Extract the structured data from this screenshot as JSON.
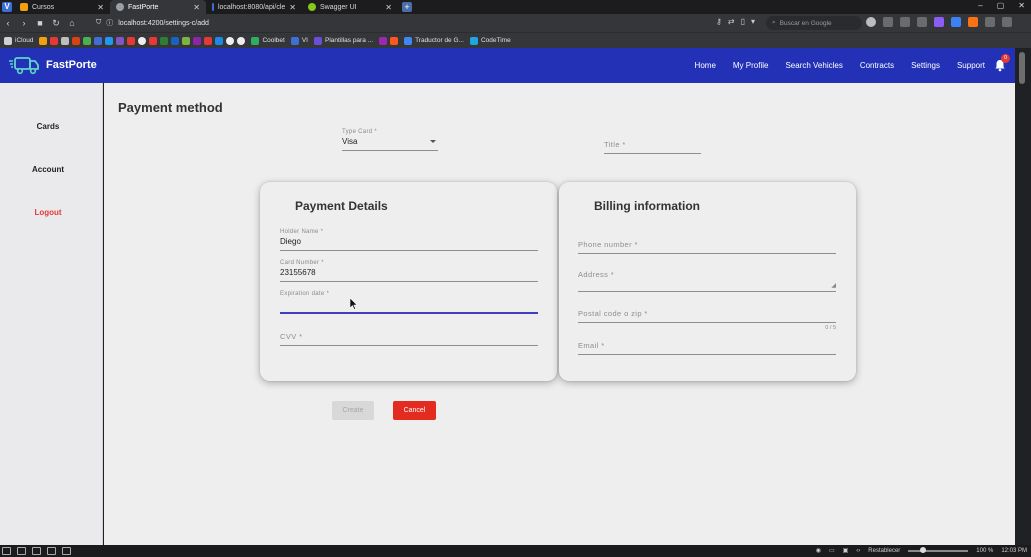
{
  "browser": {
    "tabs": [
      {
        "title": "Cursos",
        "favicon_color": "#f2a10c",
        "active": false
      },
      {
        "title": "FastPorte",
        "favicon_color": "#9aa0a6",
        "active": true
      },
      {
        "title": "localhost:8080/api/cle",
        "favicon_color": "#3a6fd8",
        "active": false
      },
      {
        "title": "Swagger UI",
        "favicon_color": "#85c81a",
        "active": false
      }
    ],
    "url": "localhost:4200/settings-c/add",
    "search_placeholder": "Buscar en Google",
    "bookmarks": [
      {
        "label": "iCloud",
        "color": "#cfcfcf"
      },
      {
        "label": "Coolbet",
        "color": "#2fae62"
      },
      {
        "label": "VI",
        "color": "#3f6fd6"
      },
      {
        "label": "Plantillas para ...",
        "color": "#6b4fd8"
      },
      {
        "label": "Traductor de G...",
        "color": "#4285f4"
      },
      {
        "label": "CodeTime",
        "color": "#1fa5e0"
      }
    ]
  },
  "app": {
    "name": "FastPorte",
    "nav": [
      "Home",
      "My Profile",
      "Search Vehicles",
      "Contracts",
      "Settings",
      "Support"
    ],
    "notification_count": "0",
    "colors": {
      "appbar": "#2331b6",
      "cancel": "#e32b1f",
      "logout": "#e53935",
      "focus_line": "#3f3fbf"
    }
  },
  "sidebar": {
    "items": [
      {
        "label": "Cards"
      },
      {
        "label": "Account"
      },
      {
        "label": "Logout"
      }
    ]
  },
  "page": {
    "title": "Payment method",
    "type_card": {
      "label": "Type Card *",
      "value": "Visa"
    },
    "title_field": {
      "placeholder": "Title *"
    }
  },
  "payment_details": {
    "heading": "Payment Details",
    "holder_name": {
      "label": "Holder Name *",
      "value": "Diego"
    },
    "card_number": {
      "label": "Card Number *",
      "value": "23155678"
    },
    "expiration_date": {
      "label": "Expiration date *",
      "value": ""
    },
    "cvv": {
      "placeholder": "CVV *"
    }
  },
  "billing_information": {
    "heading": "Billing information",
    "phone_number": {
      "placeholder": "Phone number *"
    },
    "address": {
      "placeholder": "Address *"
    },
    "postal_code": {
      "placeholder": "Postal code o zip *",
      "counter": "0 / 5"
    },
    "email": {
      "placeholder": "Email *"
    }
  },
  "actions": {
    "create_label": "Create",
    "cancel_label": "Cancel"
  },
  "taskbar": {
    "restore_label": "Restablecer",
    "zoom": "100 %",
    "time": "12:03 PM"
  }
}
